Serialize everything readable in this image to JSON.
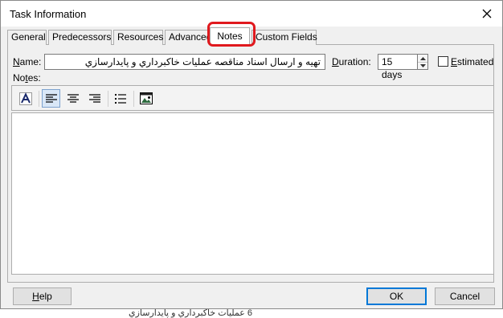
{
  "dialog": {
    "title": "Task Information",
    "close_glyph": "✕"
  },
  "tabs": [
    {
      "label": "General",
      "active": false
    },
    {
      "label": "Predecessors",
      "active": false
    },
    {
      "label": "Resources",
      "active": false
    },
    {
      "label": "Advanced",
      "active": false
    },
    {
      "label": "Notes",
      "active": true
    },
    {
      "label": "Custom Fields",
      "active": false
    }
  ],
  "name_field": {
    "label_prefix": "N",
    "label_rest": "ame:",
    "value": "تهیه و ارسال اسناد مناقصه عملیات خاکبرداري و پایدارسازي"
  },
  "duration_field": {
    "label_prefix": "D",
    "label_rest": "uration:",
    "value": "15 days"
  },
  "estimated": {
    "label_prefix": "E",
    "label_rest": "stimated",
    "checked": false
  },
  "notes": {
    "label_prefix": "No",
    "label_underlined": "t",
    "label_rest": "es:",
    "content": ""
  },
  "toolbar_icons": [
    "font-icon",
    "align-left-icon",
    "align-center-icon",
    "align-right-icon",
    "bullet-list-icon",
    "insert-object-icon"
  ],
  "buttons": {
    "help_prefix": "H",
    "help_rest": "elp",
    "ok": "OK",
    "cancel": "Cancel"
  },
  "background": {
    "fragment": "6 عملیات خاکبرداري و پایدارسازي"
  },
  "colors": {
    "highlight": "#e0191e",
    "default_button_border": "#0078d7"
  }
}
